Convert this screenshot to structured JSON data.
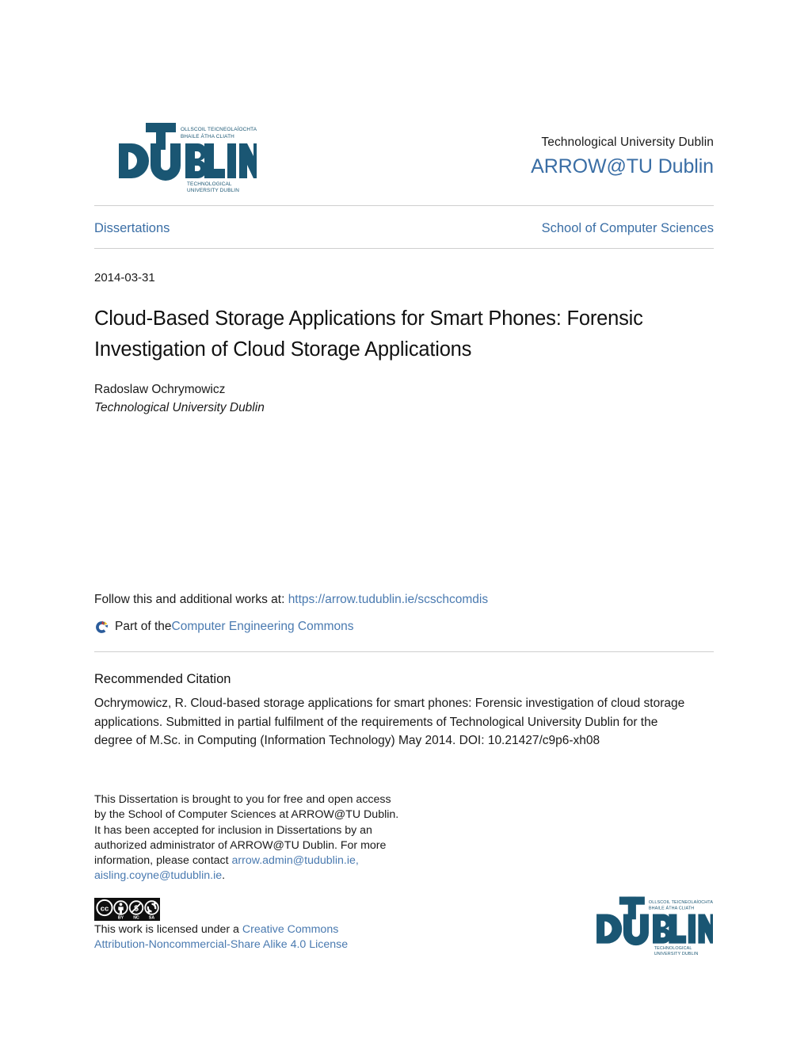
{
  "header": {
    "logo": {
      "icon": "tu-dublin-logo",
      "wordmark": "DUBLIN",
      "irish_line1": "OLLSCOIL TEICNEOLAÍOCHTA",
      "irish_line2": "BHAILE ÁTHA CLIATH",
      "english_line1": "TECHNOLOGICAL",
      "english_line2": "UNIVERSITY DUBLIN",
      "color": "#1a5673"
    },
    "university_name": "Technological University Dublin",
    "repository_name": "ARROW@TU Dublin",
    "repository_color": "#3a6ea5"
  },
  "nav": {
    "collection": "Dissertations",
    "school": "School of Computer Sciences"
  },
  "record": {
    "date": "2014-03-31",
    "title": "Cloud-Based Storage Applications for Smart Phones: Forensic Investigation of Cloud Storage Applications",
    "author": "Radoslaw Ochrymowicz",
    "affiliation": "Technological University Dublin"
  },
  "follow": {
    "prefix": "Follow this and additional works at: ",
    "url": "https://arrow.tudublin.ie/scschcomdis",
    "network_icon": "digital-commons-network-icon",
    "part_of_prefix": "Part of the ",
    "commons_link": "Computer Engineering Commons"
  },
  "citation": {
    "heading": "Recommended Citation",
    "text": "Ochrymowicz, R. Cloud-based storage applications for smart phones: Forensic investigation of cloud storage applications. Submitted in partial fulfilment of the requirements of Technological University Dublin for the degree of M.Sc. in Computing (Information Technology) May 2014. DOI: 10.21427/c9p6-xh08"
  },
  "footer": {
    "note_part1": "This Dissertation is brought to you for free and open access by the School of Computer Sciences at ARROW@TU Dublin. It has been accepted for inclusion in Dissertations by an authorized administrator of ARROW@TU Dublin. For more information, please contact ",
    "email1": "arrow.admin@tudublin.ie,",
    "email2": "aisling.coyne@tudublin.ie",
    "note_end": ".",
    "cc_badge": "cc-by-nc-sa-badge",
    "cc_marks": [
      "CC",
      "BY",
      "NC",
      "SA"
    ],
    "license_prefix": "This work is licensed under a ",
    "license_link_line1": "Creative Commons",
    "license_link_line2": "Attribution-Noncommercial-Share Alike 4.0 License",
    "link_color": "#4a7ab0"
  }
}
